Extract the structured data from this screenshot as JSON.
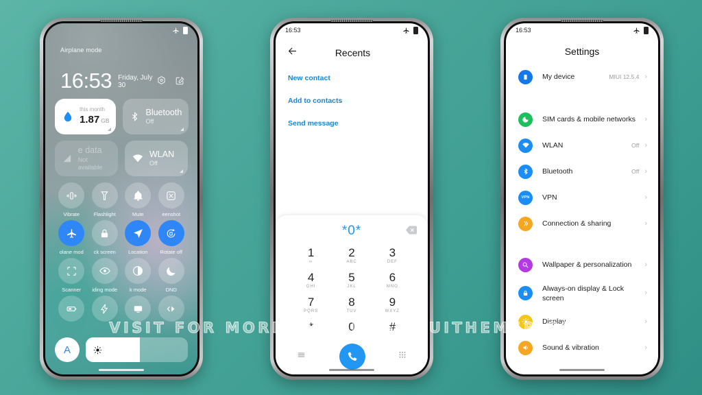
{
  "watermark": {
    "text": "VISIT FOR MORE THEMES - MIUITHEMER.COM"
  },
  "phone1": {
    "status": {
      "time": "",
      "label": "Airplane mode",
      "airplane_icon": "airplane-icon",
      "battery_icon": "battery-icon"
    },
    "clock": {
      "time": "16:53",
      "date": "Friday, July 30"
    },
    "header_icons": [
      {
        "name": "settings-gear-icon"
      },
      {
        "name": "edit-icon"
      }
    ],
    "big_tiles": [
      {
        "style": "white",
        "icon": "data-drop-icon",
        "sub": "this month",
        "main": "1.87",
        "unit": "GB"
      },
      {
        "style": "frost",
        "icon": "bluetooth-icon",
        "main": "Bluetooth",
        "state": "Off"
      },
      {
        "style": "dim",
        "icon": "signal-icon",
        "main": "e data",
        "state": "Not available"
      },
      {
        "style": "frost",
        "icon": "wlan-icon",
        "main": "WLAN",
        "state": "Off"
      }
    ],
    "toggles": [
      {
        "label": "Vibrate",
        "icon": "vibrate-icon",
        "on": false
      },
      {
        "label": "Flashlight",
        "icon": "flashlight-icon",
        "on": false
      },
      {
        "label": "Mute",
        "icon": "bell-icon",
        "on": false
      },
      {
        "label": "eenshot",
        "icon": "screenshot-icon",
        "on": false
      },
      {
        "label": "olane mod",
        "icon": "airplane-icon",
        "on": true
      },
      {
        "label": "ck screen",
        "icon": "lock-icon",
        "on": false
      },
      {
        "label": "Location",
        "icon": "location-icon",
        "on": true
      },
      {
        "label": "Rotate off",
        "icon": "rotate-icon",
        "on": true
      },
      {
        "label": "Scanner",
        "icon": "scanner-icon",
        "on": false
      },
      {
        "label": "iding mode",
        "icon": "eye-icon",
        "on": false
      },
      {
        "label": "k mode",
        "icon": "contrast-icon",
        "on": false
      },
      {
        "label": "DND",
        "icon": "moon-icon",
        "on": false
      },
      {
        "label": "",
        "icon": "battery-saver-icon",
        "on": false
      },
      {
        "label": "",
        "icon": "bolt-icon",
        "on": false
      },
      {
        "label": "",
        "icon": "cast-icon",
        "on": false
      },
      {
        "label": "",
        "icon": "transfer-icon",
        "on": false
      }
    ],
    "brightness": {
      "auto_label": "A",
      "icon": "sun-icon",
      "level_percent": 53
    }
  },
  "phone2": {
    "status": {
      "time": "16:53",
      "airplane_icon": "airplane-icon",
      "battery_icon": "battery-icon"
    },
    "header": {
      "back_icon": "back-arrow-icon",
      "title": "Recents"
    },
    "links": [
      {
        "label": "New contact"
      },
      {
        "label": "Add to contacts"
      },
      {
        "label": "Send message"
      }
    ],
    "dialpad": {
      "entry": "*0*",
      "delete_icon": "backspace-icon",
      "keys": [
        {
          "num": "1",
          "sub": "∞"
        },
        {
          "num": "2",
          "sub": "ABC"
        },
        {
          "num": "3",
          "sub": "DEF"
        },
        {
          "num": "4",
          "sub": "GHI"
        },
        {
          "num": "5",
          "sub": "JKL"
        },
        {
          "num": "6",
          "sub": "MNO"
        },
        {
          "num": "7",
          "sub": "PQRS"
        },
        {
          "num": "8",
          "sub": "TUV"
        },
        {
          "num": "9",
          "sub": "WXYZ"
        },
        {
          "num": "*",
          "sub": ""
        },
        {
          "num": "0",
          "sub": ""
        },
        {
          "num": "#",
          "sub": ""
        }
      ],
      "actions": {
        "menu_icon": "menu-icon",
        "call_icon": "call-icon",
        "keypad_icon": "keypad-icon"
      }
    }
  },
  "phone3": {
    "status": {
      "time": "16:53",
      "airplane_icon": "airplane-icon",
      "battery_icon": "battery-icon"
    },
    "title": "Settings",
    "groups": [
      {
        "rows": [
          {
            "label": "My device",
            "value": "MIUI 12.5.4",
            "icon": "phone-icon",
            "color": "#1677e8"
          }
        ]
      },
      {
        "rows": [
          {
            "label": "SIM cards & mobile networks",
            "value": "",
            "icon": "sim-icon",
            "color": "#1dbf5c"
          },
          {
            "label": "WLAN",
            "value": "Off",
            "icon": "wifi-icon",
            "color": "#1b8df5"
          },
          {
            "label": "Bluetooth",
            "value": "Off",
            "icon": "bluetooth-icon",
            "color": "#1b8df5"
          },
          {
            "label": "VPN",
            "value": "",
            "icon": "vpn-icon",
            "color": "#1b8df5"
          },
          {
            "label": "Connection & sharing",
            "value": "",
            "icon": "sharing-icon",
            "color": "#f5a623"
          }
        ]
      },
      {
        "rows": [
          {
            "label": "Wallpaper & personalization",
            "value": "",
            "icon": "wallpaper-icon",
            "color": "#b23ae0"
          },
          {
            "label": "Always-on display & Lock screen",
            "value": "",
            "icon": "lock-icon",
            "color": "#1b8df5"
          },
          {
            "label": "Display",
            "value": "",
            "icon": "display-icon",
            "color": "#f5c518"
          },
          {
            "label": "Sound & vibration",
            "value": "",
            "icon": "sound-icon",
            "color": "#f5a623"
          }
        ]
      }
    ],
    "chevron": "›"
  }
}
